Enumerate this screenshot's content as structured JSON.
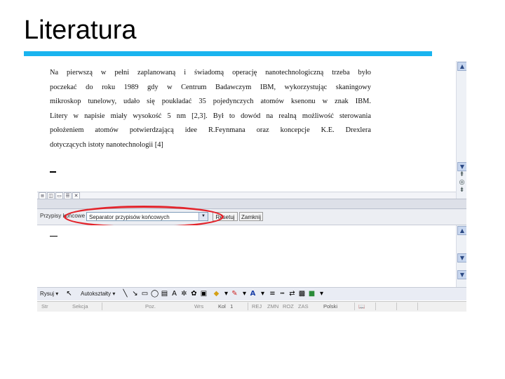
{
  "slide": {
    "title": "Literatura",
    "accent_color": "#19b4ef"
  },
  "document": {
    "lines": [
      "Na pierwszą w pełni zaplanowaną i świadomą operację nanotechnologiczną trzeba było",
      "poczekać do roku 1989 gdy w Centrum Badawczym IBM, wykorzystując skaningowy",
      "mikroskop tunelowy, udało się poukładać 35 pojedynczych atomów ksenonu w znak IBM.",
      "Litery w napisie miały wysokość 5 nm [2,3]. Był to dowód na realną możliwość sterowania",
      "położeniem atomów potwierdzającą idee R.Feynmana oraz koncepcje K.E. Drexlera",
      "dotyczących istoty nanotechnologii [4]"
    ]
  },
  "footnote_bar": {
    "label": "Przypisy końcowe",
    "select_value": "Separator przypisów końcowych",
    "reset_label": "Resetuj",
    "close_label": "Zamknij",
    "highlight_color": "#e3242b"
  },
  "draw_toolbar": {
    "draw_label": "Rysuj",
    "autoshapes_label": "Autokształty"
  },
  "status_bar": {
    "page": "Str",
    "section": "Sekcja",
    "position": "Poz.",
    "line": "Wrs",
    "column": "Kol",
    "column_value": "1",
    "rec": "REJ",
    "trk": "ZMN",
    "ext": "ROZ",
    "ovr": "ZAS",
    "language": "Polski"
  }
}
